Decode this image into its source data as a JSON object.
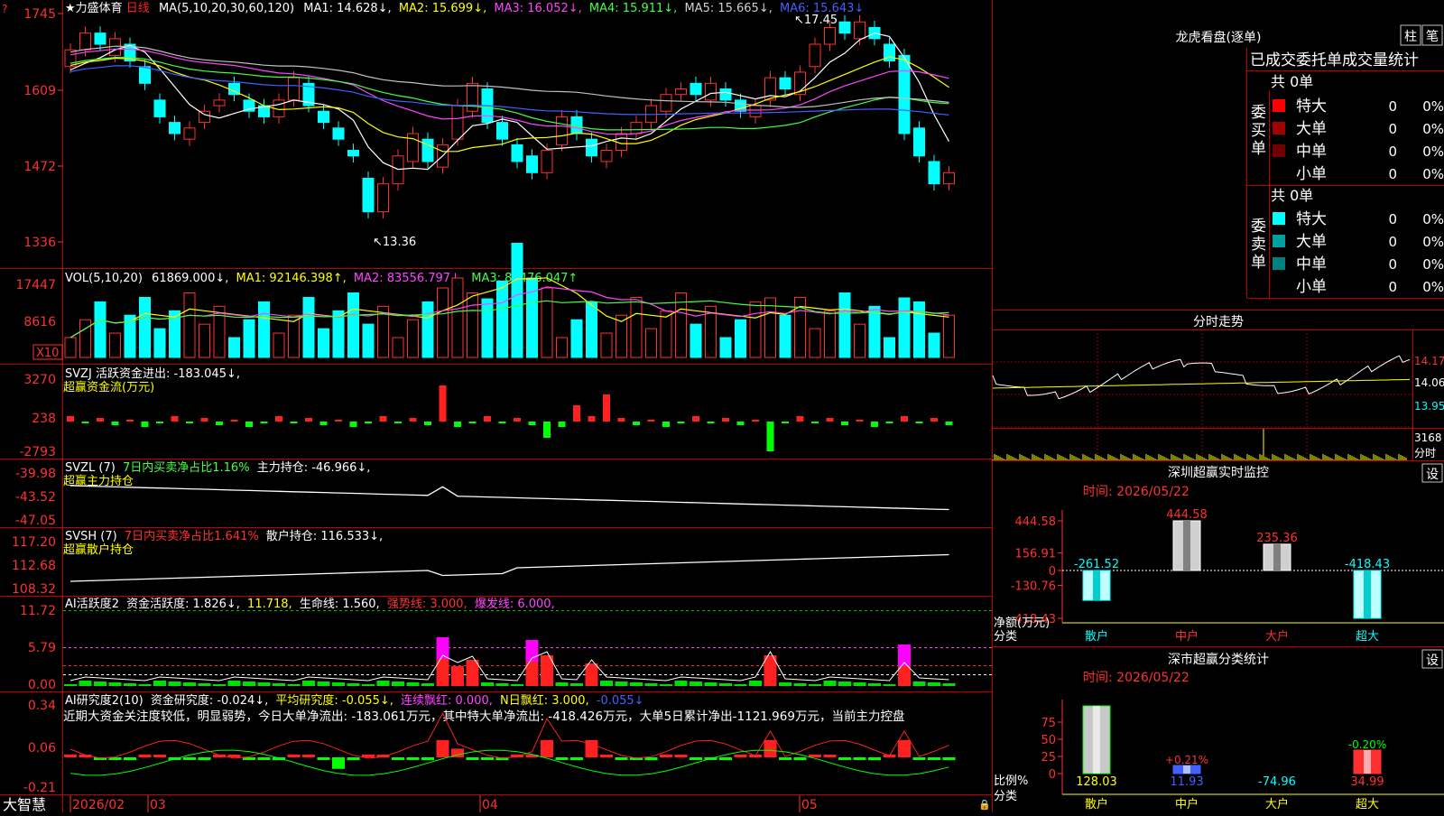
{
  "stock": {
    "name": "★力盛体育",
    "period": "日线",
    "ma_label": "MA(5,10,20,30,60,120)",
    "ma": [
      {
        "label": "MA1: 14.628↓,",
        "color": "#ffffff"
      },
      {
        "label": "MA2: 15.699↓,",
        "color": "#ffff00"
      },
      {
        "label": "MA3: 16.052↓,",
        "color": "#ff44ff"
      },
      {
        "label": "MA4: 15.911↓,",
        "color": "#44ff44"
      },
      {
        "label": "MA5: 15.665↓,",
        "color": "#c0c0c0"
      },
      {
        "label": "MA6: 15.643↓",
        "color": "#4060ff"
      }
    ],
    "price_axis": [
      "1745",
      "1609",
      "1472",
      "1336"
    ],
    "high_label": "17.45",
    "low_label": "13.36"
  },
  "vol": {
    "title": "VOL(5,10,20)",
    "value": "61869.000↓,",
    "ma1": "MA1: 92146.398↑,",
    "ma2": "MA2: 83556.797↓,",
    "ma3": "MA3: 81476.047↑",
    "axis": [
      "17447",
      "8616"
    ],
    "unit": "X10"
  },
  "svzj": {
    "title": "SVZJ  活跃资金进出: -183.045↓,",
    "subtitle": "超赢资金流(万元)",
    "axis": [
      "3270",
      "238",
      "-2793"
    ]
  },
  "svzl": {
    "title": "SVZL (7)",
    "ratio": "7日内买卖净占比1.16%",
    "holding": "主力持仓: -46.966↓,",
    "subtitle": "超赢主力持仓",
    "axis": [
      "-39.98",
      "-43.52",
      "-47.05"
    ]
  },
  "svsh": {
    "title": "SVSH (7)",
    "ratio": "7日内买卖净占比1.641%",
    "holding": "散户持仓: 116.533↓,",
    "subtitle": "超赢散户持仓",
    "axis": [
      "117.20",
      "112.68",
      "108.32"
    ]
  },
  "ai_active": {
    "title": "AI活跃度2",
    "a": "资金活跃度: 1.826↓,",
    "b": "11.718,",
    "c": "生命线: 1.560,",
    "d": "强势线: 3.000,",
    "e": "爆发线: 6.000,",
    "axis": [
      "11.72",
      "5.79",
      "0.00"
    ]
  },
  "ai_research": {
    "title": "AI研究度2(10)",
    "a": "资金研究度: -0.024↓,",
    "b": "平均研究度: -0.055↓,",
    "c": "连续飘红: 0.000,",
    "d": "N日飘红: 3.000,",
    "e": "-0.055↓",
    "summary": "近期大资金关注度较低，明显弱势，今日大单净流出: -183.061万元，其中特大单净流出: -418.426万元，大单5日累计净出-1121.969万元，当前主力控盘",
    "axis": [
      "0.34",
      "0.06",
      "-0.21"
    ]
  },
  "date_axis": {
    "left_label": "大智慧",
    "labels": [
      "2026/02",
      "03",
      "04",
      "05"
    ]
  },
  "lhb": {
    "title": "龙虎看盘(逐单)",
    "btn_zhu": "柱",
    "btn_bi": "笔",
    "header": "已成交委托单成交量统计",
    "buy_label": "委买单",
    "sell_label": "委卖单",
    "buy_total": "共 0单",
    "sell_total": "共 0单",
    "buy_rows": [
      {
        "label": "特大",
        "val": "0",
        "pct": "0%",
        "color": "#ff0000"
      },
      {
        "label": "大单",
        "val": "0",
        "pct": "0%",
        "color": "#a00000"
      },
      {
        "label": "中单",
        "val": "0",
        "pct": "0%",
        "color": "#700000"
      },
      {
        "label": "小单",
        "val": "0",
        "pct": "0%",
        "color": "#000000"
      }
    ],
    "sell_rows": [
      {
        "label": "特大",
        "val": "0",
        "pct": "0%",
        "color": "#00ffff"
      },
      {
        "label": "大单",
        "val": "0",
        "pct": "0%",
        "color": "#00a0a0"
      },
      {
        "label": "中单",
        "val": "0",
        "pct": "0%",
        "color": "#008080"
      },
      {
        "label": "小单",
        "val": "0",
        "pct": "0%",
        "color": "#000000"
      }
    ]
  },
  "fenshi": {
    "title": "分时走势",
    "axis": [
      "14.17",
      "14.06",
      "13.95"
    ],
    "vol_label": "3168",
    "vol_unit": "分时"
  },
  "sz_monitor": {
    "title": "深圳超赢实时监控",
    "set_btn": "设",
    "time": "时间: 2026/05/22",
    "axis": [
      "444.58",
      "156.91",
      "0",
      "-130.76",
      "-418.43"
    ],
    "unit_label": "净额(万元)",
    "cat_label": "分类",
    "bars": [
      {
        "cat": "散户",
        "value": -261.52,
        "label": "-261.52"
      },
      {
        "cat": "中户",
        "value": 444.58,
        "label": "444.58"
      },
      {
        "cat": "大户",
        "value": 235.36,
        "label": "235.36"
      },
      {
        "cat": "超大",
        "value": -418.43,
        "label": "-418.43"
      }
    ]
  },
  "sz_stats": {
    "title": "深市超赢分类统计",
    "set_btn": "设",
    "time": "时间: 2026/05/22",
    "axis": [
      "75",
      "50",
      "25",
      "0"
    ],
    "ratio_label": "比例%",
    "cat_label": "分类",
    "bars": [
      {
        "cat": "散户",
        "value": 128.03,
        "label": "128.03",
        "pct": ""
      },
      {
        "cat": "中户",
        "value": 11.93,
        "label": "11.93",
        "pct": "+0.21%"
      },
      {
        "cat": "大户",
        "value": -74.96,
        "label": "-74.96",
        "pct": ""
      },
      {
        "cat": "超大",
        "value": 34.99,
        "label": "34.99",
        "pct": "-0.20%"
      }
    ]
  }
}
